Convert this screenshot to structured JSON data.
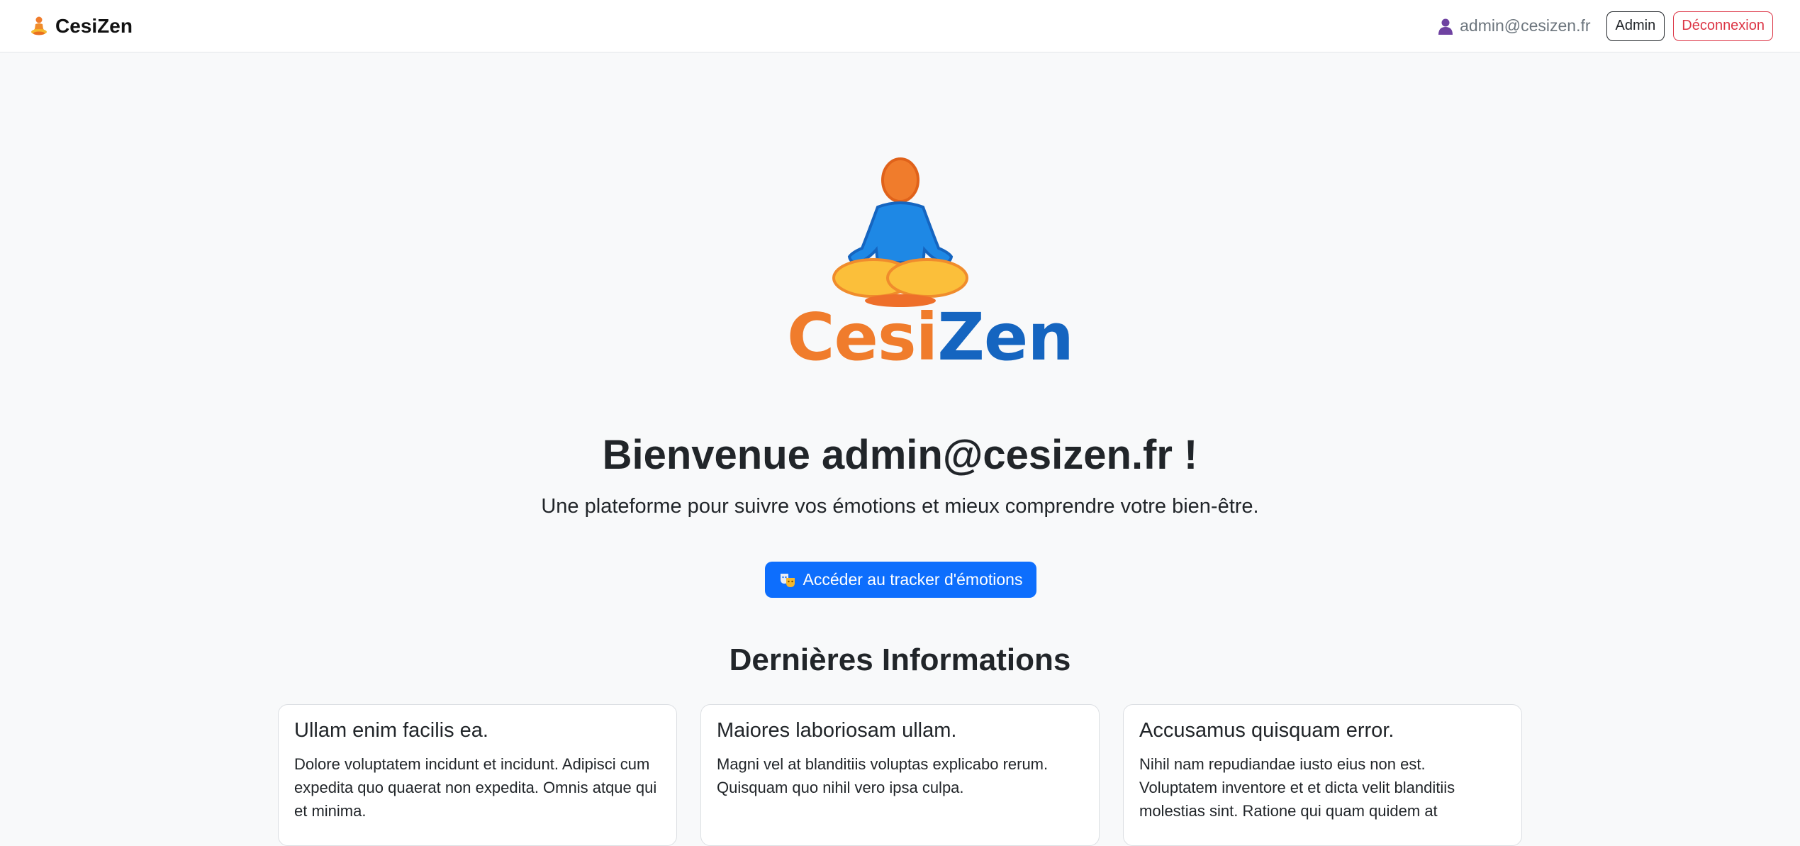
{
  "navbar": {
    "brand_name": "CesiZen",
    "user_email": "admin@cesizen.fr",
    "admin_label": "Admin",
    "logout_label": "Déconnexion"
  },
  "logo": {
    "part1": "Cesi",
    "part2": "Zen"
  },
  "hero": {
    "welcome": "Bienvenue admin@cesizen.fr !",
    "subtitle": "Une plateforme pour suivre vos émotions et mieux comprendre votre bien-être.",
    "cta_label": "Accéder au tracker d'émotions"
  },
  "news": {
    "title": "Dernières Informations",
    "cards": [
      {
        "title": "Ullam enim facilis ea.",
        "text": "Dolore voluptatem incidunt et incidunt. Adipisci cum expedita quo quaerat non expedita. Omnis atque qui et minima."
      },
      {
        "title": "Maiores laboriosam ullam.",
        "text": "Magni vel at blanditiis voluptas explicabo rerum. Quisquam quo nihil vero ipsa culpa."
      },
      {
        "title": "Accusamus quisquam error.",
        "text": "Nihil nam repudiandae iusto eius non est. Voluptatem inventore et et dicta velit blanditiis molestias sint. Ratione qui quam quidem at"
      }
    ]
  },
  "colors": {
    "primary": "#0d6efd",
    "danger": "#dc3545",
    "logo_orange": "#f07c2c",
    "logo_blue": "#1565c0"
  },
  "icons": {
    "brand": "meditating-person-icon",
    "user": "user-icon",
    "cta": "theater-masks-icon"
  }
}
